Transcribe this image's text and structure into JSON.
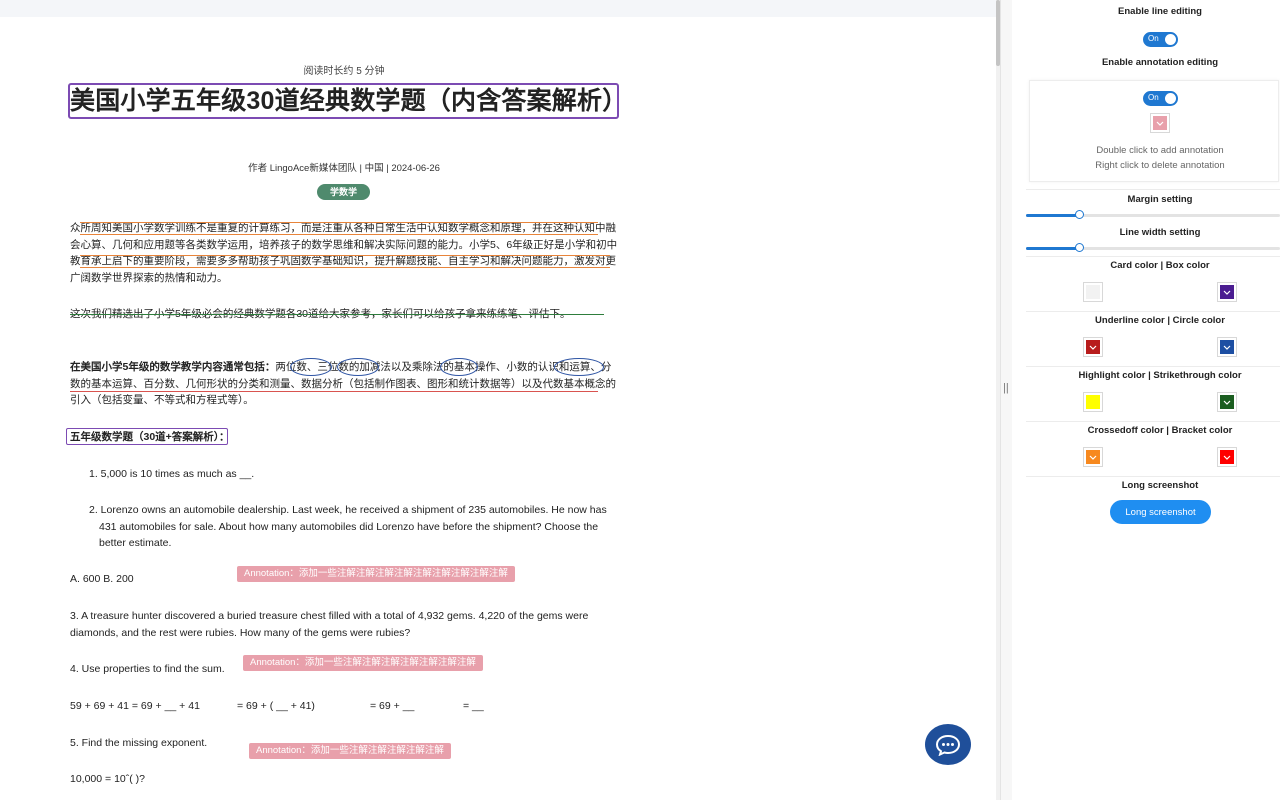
{
  "article": {
    "reading_time": "阅读时长约 5 分钟",
    "title": "美国小学五年级30道经典数学题（内含答案解析）",
    "byline": "作者 LingoAce新媒体团队 | 中国 | 2024-06-26",
    "tag": "学数学",
    "para1": "众所周知美国小学数学训练不是重复的计算练习，而是注重从各种日常生活中认知数学概念和原理，并在这种认知中融会心算、几何和应用题等各类数学运用，培养孩子的数学思维和解决实际问题的能力。小学5、6年级正好是小学和初中教育承上启下的重要阶段，需要多多帮助孩子巩固数学基础知识，提升解题技能、自主学习和解决问题能力，激发对更广阔数学世界探索的热情和动力。",
    "para2": "这次我们精选出了小学5年级必会的经典数学题各30道给大家参考，家长们可以给孩子拿来练练笔、评估下。",
    "para3_bold": "在美国小学5年级的数学教学内容通常包括：",
    "para3_rest": "两位数、三位数的加减法以及乘除法的基本操作、小数的认识和运算、分数的基本运算、百分数、几何形状的分类和测量、数据分析（包括制作图表、图形和统计数据等）以及代数基本概念的引入（包括变量、不等式和方程式等）。",
    "section_heading": "五年级数学题（30道+答案解析）：",
    "q1": "1. 5,000 is 10 times as much as __.",
    "q2": "2. Lorenzo owns an automobile dealership. Last week, he received a shipment of 235 automobiles. He now has 431 automobiles for sale. About how many automobiles did Lorenzo have before the shipment? Choose the better estimate.",
    "q2_choices": "A. 600    B. 200",
    "q3": "3. A treasure hunter discovered a buried treasure chest filled with a total of 4,932 gems. 4,220 of the gems were diamonds, and the rest were rubies. How many of the gems were rubies?",
    "q4": "4. Use  properties to find the  sum.",
    "q4_a": "59 + 69 + 41 = 69 + __ + 41",
    "q4_b": "= 69 + ( __ + 41)",
    "q4_c": "= 69 + __",
    "q4_d": "= __",
    "q5": "5. Find the missing exponent.",
    "q5_eq": "10,000 = 10ˆ( )?",
    "annotation1": "Annotation：添加一些注解注解注解注解注解注解注解注解注解",
    "annotation2": "Annotation：添加一些注解注解注解注解注解注解注解",
    "annotation3": "Annotation：添加一些注解注解注解注解注解"
  },
  "panel": {
    "line_editing_label": "Enable line editing",
    "line_editing_toggle": "On",
    "annotation_editing_label": "Enable annotation editing",
    "annotation_editing_toggle": "On",
    "hint1": "Double click to add annotation",
    "hint2": "Right click to delete annotation",
    "margin_label": "Margin setting",
    "margin_value": 0.21,
    "line_width_label": "Line width setting",
    "line_width_value": 0.21,
    "card_box_label": "Card color | Box color",
    "underline_circle_label": "Underline color | Circle color",
    "highlight_strike_label": "Highlight color | Strikethrough color",
    "crossed_bracket_label": "Crossedoff color | Bracket color",
    "long_shot_label": "Long screenshot",
    "long_shot_button": "Long screenshot"
  },
  "colors": {
    "annotation": "#e8a0ab",
    "card": "#f2f2f2",
    "box": "#4b1d91",
    "underline": "#b81c1c",
    "circle": "#1d4fa3",
    "highlight": "#ffff00",
    "strikethrough": "#1b5e20",
    "crossedoff": "#f7891f",
    "bracket": "#ff0000",
    "accent": "#1f78d1"
  },
  "icons": {
    "chat": "chat-bubble-icon",
    "swatch_arrow": "chevron-down-icon",
    "grip": "drag-handle-icon"
  }
}
